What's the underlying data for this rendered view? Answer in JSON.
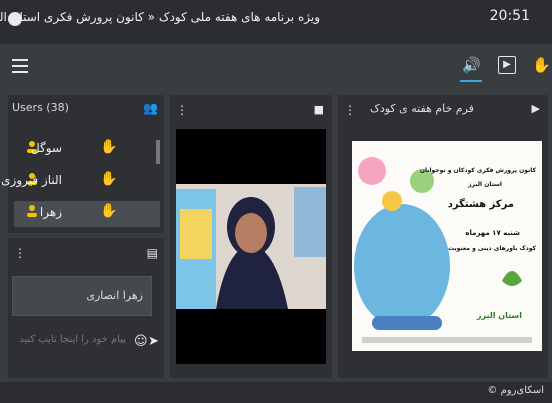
{
  "window": {
    "title": "ویژه برنامه های هفته ملی کودک « کانون پرورش فکری استان البرز",
    "time": "20:51"
  },
  "users": {
    "label": "Users (38)",
    "list": [
      {
        "name": "سوگل"
      },
      {
        "name": "الناز فیروزی"
      },
      {
        "name": "زهرا"
      }
    ]
  },
  "chat": {
    "message": "زهرا انصاری",
    "input_placeholder": "پیام خود را اینجا تایپ کنید"
  },
  "document": {
    "title": "فرم خام هفته ی کودک",
    "lines": [
      "کانون پرورش فکری کودکان و نوجوانان",
      "استان البرز",
      "مرکز هشتگرد",
      "شنبه ۱۷ مهرماه",
      "کودک باورهای دینی و معنویت",
      "استان البرز"
    ]
  },
  "footer": {
    "brand": "اسکای‌روم ©"
  },
  "colors": {
    "accent": "#3ba3e8",
    "user_icon": "#f2c200"
  }
}
